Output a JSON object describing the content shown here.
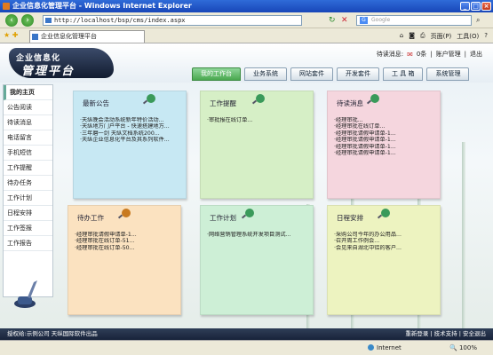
{
  "browser": {
    "title": "企业信息化管理平台 - Windows Internet Explorer",
    "url": "http://localhost/bsp/cms/index.aspx",
    "search_placeholder": "Google",
    "tab_title": "企业信息化管理平台",
    "tools": {
      "page": "页面(P)",
      "tools": "工具(O)",
      "help": "?"
    },
    "status": {
      "zone": "Internet",
      "zoom": "100%"
    }
  },
  "header": {
    "logo_line1": "企业信息化",
    "logo_line2": "管理平台",
    "pending_label": "待读消息:",
    "pending_count": "0条",
    "account_link": "账户管理",
    "logout_link": "退出"
  },
  "nav": {
    "tabs": [
      {
        "label": "我的工作台"
      },
      {
        "label": "业务系统"
      },
      {
        "label": "网站套件"
      },
      {
        "label": "开发套件"
      },
      {
        "label": "工 具 箱"
      },
      {
        "label": "系统管理"
      }
    ]
  },
  "sidebar": {
    "items": [
      {
        "label": "我的主页"
      },
      {
        "label": "公告阅读"
      },
      {
        "label": "待读消息"
      },
      {
        "label": "电话留言"
      },
      {
        "label": "手机短信"
      },
      {
        "label": "工作提醒"
      },
      {
        "label": "待办任务"
      },
      {
        "label": "工作计划"
      },
      {
        "label": "日程安排"
      },
      {
        "label": "工作签报"
      },
      {
        "label": "工作报告"
      }
    ]
  },
  "notes": [
    {
      "title": "最新公告",
      "color": "#c7e8f3",
      "pin": "#3a9a5a",
      "lines": [
        "·天纵晚会活动系统新年特价活动...",
        "·天纵地方门户平台 - 快速搭建地方...",
        "·三年磨一剑 天纵文档系统200...",
        "·天纵企业信息化平台及其系列软件..."
      ]
    },
    {
      "title": "工作提醒",
      "color": "#d6efc6",
      "pin": "#3a9a5a",
      "lines": [
        "·审批报在线订单..."
      ]
    },
    {
      "title": "待读消息",
      "color": "#f5d6de",
      "pin": "#3a9a5a",
      "lines": [
        "·经理审批...",
        "·经理审批在线订单...",
        "·经理审批请假申请单-1...",
        "·经理审批请假申请单-1...",
        "·经理审批请假申请单-1...",
        "·经理审批请假申请单-1..."
      ]
    },
    {
      "title": "待办工作",
      "color": "#fbe2c0",
      "pin": "#c87a20",
      "lines": [
        "·经理审批请假申请单-1...",
        "·经理审批在线订单-51...",
        "·经理审批在线订单-50..."
      ]
    },
    {
      "title": "工作计划",
      "color": "#cdefd6",
      "pin": "#3a9a5a",
      "lines": [
        "·网络营销管理系统开发项目测试..."
      ]
    },
    {
      "title": "日程安排",
      "color": "#edf3c0",
      "pin": "#3a9a5a",
      "lines": [
        "·采购公司今年的办公用品...",
        "·召开周工作例会...",
        "·会见来自湖北中铝的客户..."
      ]
    }
  ],
  "footer": {
    "left": "授权给:示例公司   天纵国际软件出品",
    "right": "重新登录 | 技术支持 | 安全退出"
  }
}
